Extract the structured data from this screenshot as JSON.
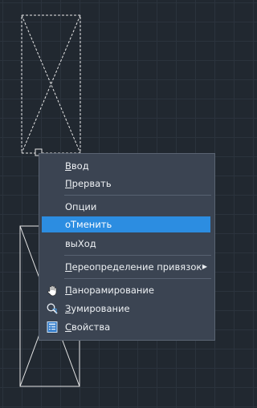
{
  "context_menu": {
    "items": [
      {
        "id": "vvod",
        "first": "В",
        "rest": "вод"
      },
      {
        "id": "prervat",
        "first": "П",
        "rest": "рервать"
      },
      {
        "id": "opcii",
        "label": "Опции"
      },
      {
        "id": "otmenit",
        "label": "оТменить",
        "state": "highlighted"
      },
      {
        "id": "vyhod",
        "label": "выХод"
      },
      {
        "id": "pereopredelenie",
        "first": "П",
        "rest": "ереопределение привязок",
        "submenu_glyph": "▶"
      },
      {
        "id": "panorama",
        "first": "П",
        "rest": "анорамирование",
        "icon": "hand-pan-icon"
      },
      {
        "id": "zoom",
        "first": "З",
        "rest": "умирование",
        "icon": "magnifier-zoom-icon"
      },
      {
        "id": "props",
        "first": "С",
        "rest": "войства",
        "icon": "properties-icon"
      }
    ]
  },
  "colors": {
    "canvas_background": "#212830",
    "grid_line": "#2b333d",
    "menu_background": "#3b4452",
    "highlight": "#2c8de1",
    "text": "#eef1f4"
  }
}
